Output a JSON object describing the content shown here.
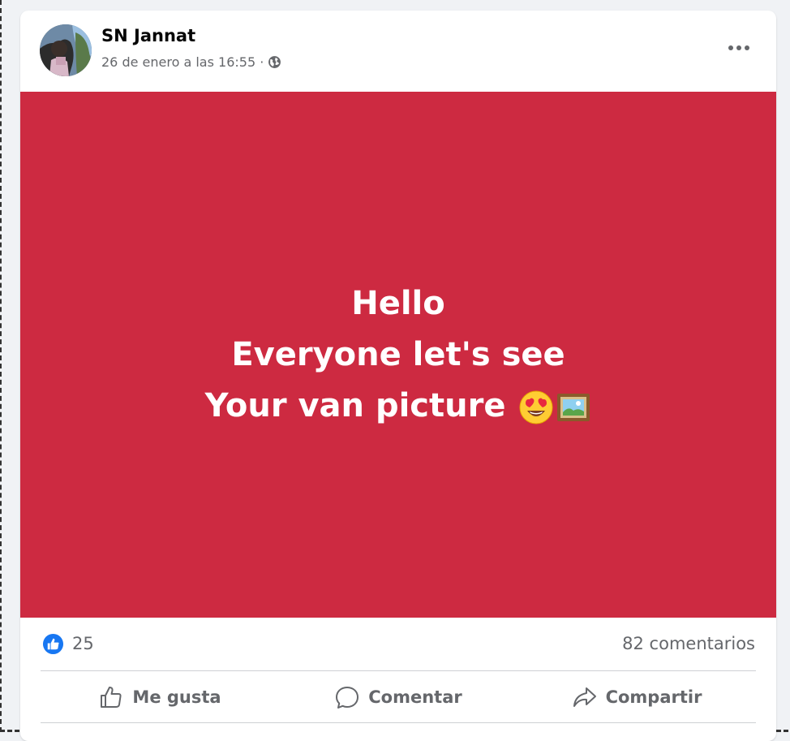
{
  "post": {
    "author": "SN Jannat",
    "timestamp": "26 de enero a las 16:55 ·",
    "privacy_icon": "globe-icon",
    "menu_icon": "more-dots-icon",
    "background_color": "#cd2a41",
    "text_lines": [
      "Hello",
      "Everyone let's see",
      "Your van picture"
    ],
    "emojis": [
      "heart-eyes-emoji",
      "framed-picture-emoji"
    ]
  },
  "stats": {
    "like_count": "25",
    "comments": "82 comentarios"
  },
  "actions": {
    "like_label": "Me gusta",
    "comment_label": "Comentar",
    "share_label": "Compartir"
  },
  "colors": {
    "accent_like": "#1877f2",
    "muted_text": "#65676b"
  }
}
